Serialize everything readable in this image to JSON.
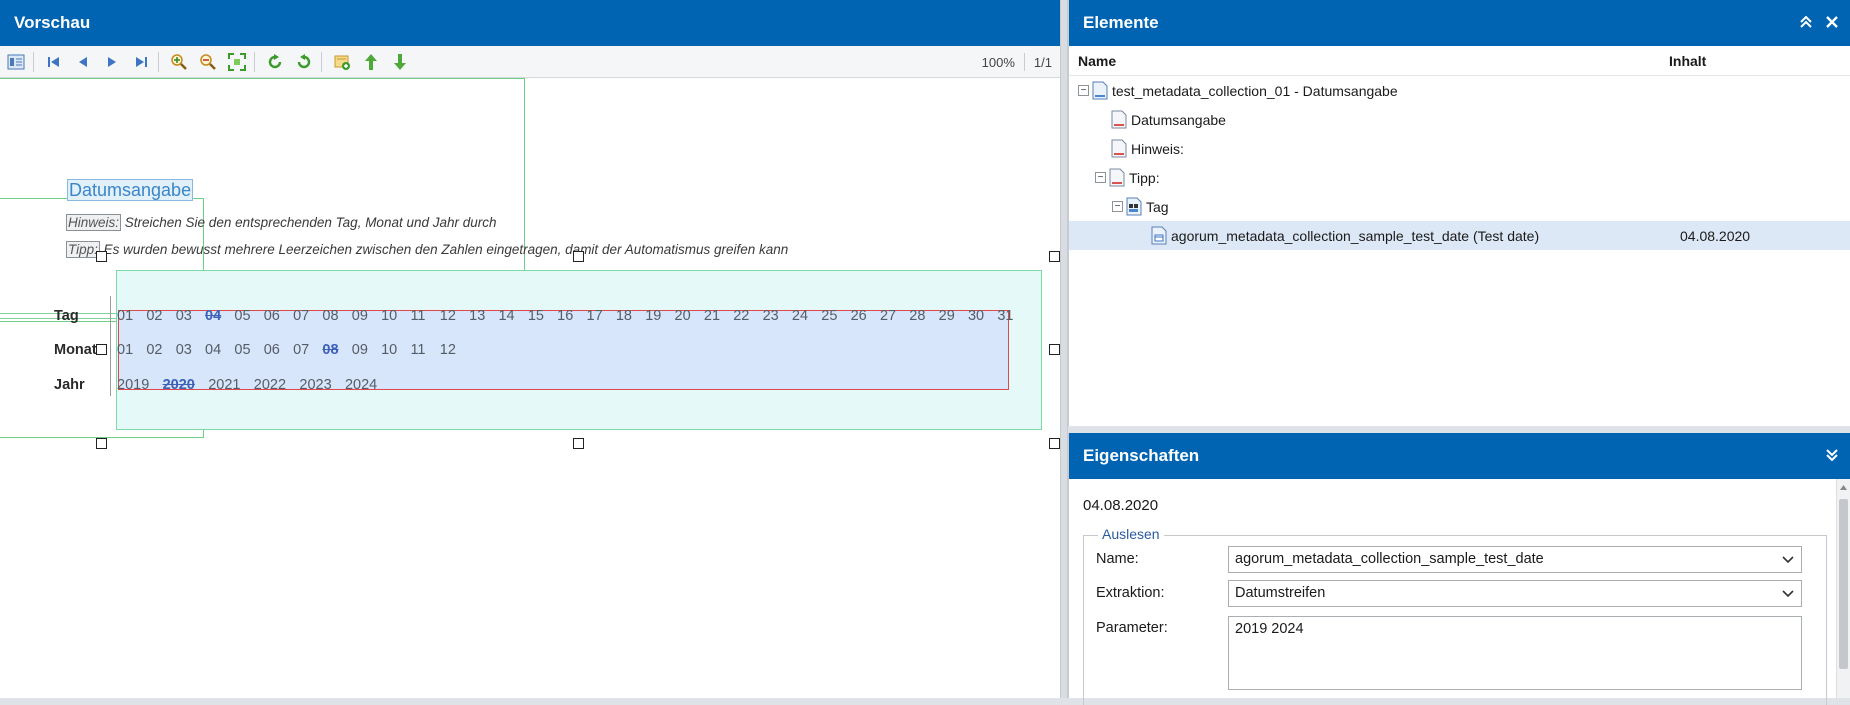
{
  "preview": {
    "title": "Vorschau",
    "zoom": "100%",
    "page": "1/1",
    "doc_title": "Datumsangabe",
    "hint_label": "Hinweis:",
    "hint_text": " Streichen Sie den entsprechenden Tag, Monat und Jahr durch",
    "tip_label": "Tipp:",
    "tip_text": " Es wurden bewusst mehrere Leerzeichen zwischen den Zahlen eingetragen, damit der Automatismus greifen kann",
    "rows": {
      "day_label": "Tag",
      "month_label": "Monat",
      "year_label": "Jahr",
      "days": [
        "01",
        "02",
        "03",
        "04",
        "05",
        "06",
        "07",
        "08",
        "09",
        "10",
        "11",
        "12",
        "13",
        "14",
        "15",
        "16",
        "17",
        "18",
        "19",
        "20",
        "21",
        "22",
        "23",
        "24",
        "25",
        "26",
        "27",
        "28",
        "29",
        "30",
        "31"
      ],
      "months": [
        "01",
        "02",
        "03",
        "04",
        "05",
        "06",
        "07",
        "08",
        "09",
        "10",
        "11",
        "12"
      ],
      "years": [
        "2019",
        "2020",
        "2021",
        "2022",
        "2023",
        "2024"
      ]
    }
  },
  "elements": {
    "title": "Elemente",
    "col_name": "Name",
    "col_content": "Inhalt",
    "tree": [
      {
        "label": "test_metadata_collection_01 - Datumsangabe",
        "value": ""
      },
      {
        "label": "Datumsangabe",
        "value": ""
      },
      {
        "label": "Hinweis:",
        "value": ""
      },
      {
        "label": "Tipp:",
        "value": ""
      },
      {
        "label": "Tag",
        "value": ""
      },
      {
        "label": "agorum_metadata_collection_sample_test_date (Test date)",
        "value": "04.08.2020"
      }
    ]
  },
  "properties": {
    "title": "Eigenschaften",
    "date": "04.08.2020",
    "group": "Auslesen",
    "name_label": "Name:",
    "name_value": "agorum_metadata_collection_sample_test_date",
    "extraction_label": "Extraktion:",
    "extraction_value": "Datumstreifen",
    "parameter_label": "Parameter:",
    "parameter_value": "2019 2024"
  },
  "colors": {
    "header": "#0064b3",
    "selection": "#dde8f6",
    "strike": "#3e62b8"
  }
}
